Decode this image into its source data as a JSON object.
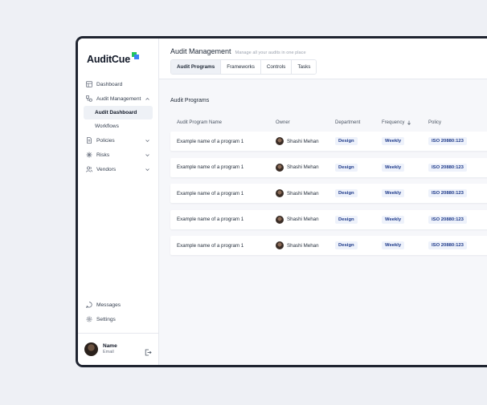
{
  "app": {
    "name": "AuditCue",
    "colors": {
      "accent_green": "#22c55e",
      "accent_blue": "#3b82f6",
      "pill_text": "#1e3a8a",
      "pill_bg": "#eef2fb"
    }
  },
  "sidebar": {
    "items": [
      {
        "label": "Dashboard",
        "icon": "layout-icon"
      },
      {
        "label": "Audit Management",
        "icon": "audit-icon",
        "expanded": true
      },
      {
        "label": "Policies",
        "icon": "document-icon"
      },
      {
        "label": "Risks",
        "icon": "asterisk-icon"
      },
      {
        "label": "Vendors",
        "icon": "users-icon"
      }
    ],
    "sub_items": [
      {
        "label": "Audit Dashboard",
        "active": true
      },
      {
        "label": "Workflows",
        "active": false
      }
    ],
    "bottom": [
      {
        "label": "Messages",
        "icon": "message-icon"
      },
      {
        "label": "Settings",
        "icon": "gear-icon"
      }
    ],
    "user": {
      "name": "Name",
      "email": "Email"
    }
  },
  "header": {
    "title": "Audit Management",
    "subtitle": "Manage all your audits in one place",
    "tabs": [
      {
        "label": "Audit Programs",
        "active": true
      },
      {
        "label": "Frameworks",
        "active": false
      },
      {
        "label": "Controls",
        "active": false
      },
      {
        "label": "Tasks",
        "active": false
      }
    ]
  },
  "table": {
    "title": "Audit Programs",
    "columns": [
      "Audit Program Name",
      "Owner",
      "Department",
      "Frequency",
      "Policy"
    ],
    "sorted_column": "Frequency",
    "rows": [
      {
        "name": "Example name of a program 1",
        "owner": "Shashi Mehan",
        "department": "Design",
        "frequency": "Weekly",
        "policy": "ISO 20880:123"
      },
      {
        "name": "Example name of a program 1",
        "owner": "Shashi Mehan",
        "department": "Design",
        "frequency": "Weekly",
        "policy": "ISO 20880:123"
      },
      {
        "name": "Example name of a program 1",
        "owner": "Shashi Mehan",
        "department": "Design",
        "frequency": "Weekly",
        "policy": "ISO 20880:123"
      },
      {
        "name": "Example name of a program 1",
        "owner": "Shashi Mehan",
        "department": "Design",
        "frequency": "Weekly",
        "policy": "ISO 20880:123"
      },
      {
        "name": "Example name of a program 1",
        "owner": "Shashi Mehan",
        "department": "Design",
        "frequency": "Weekly",
        "policy": "ISO 20880:123"
      }
    ]
  }
}
